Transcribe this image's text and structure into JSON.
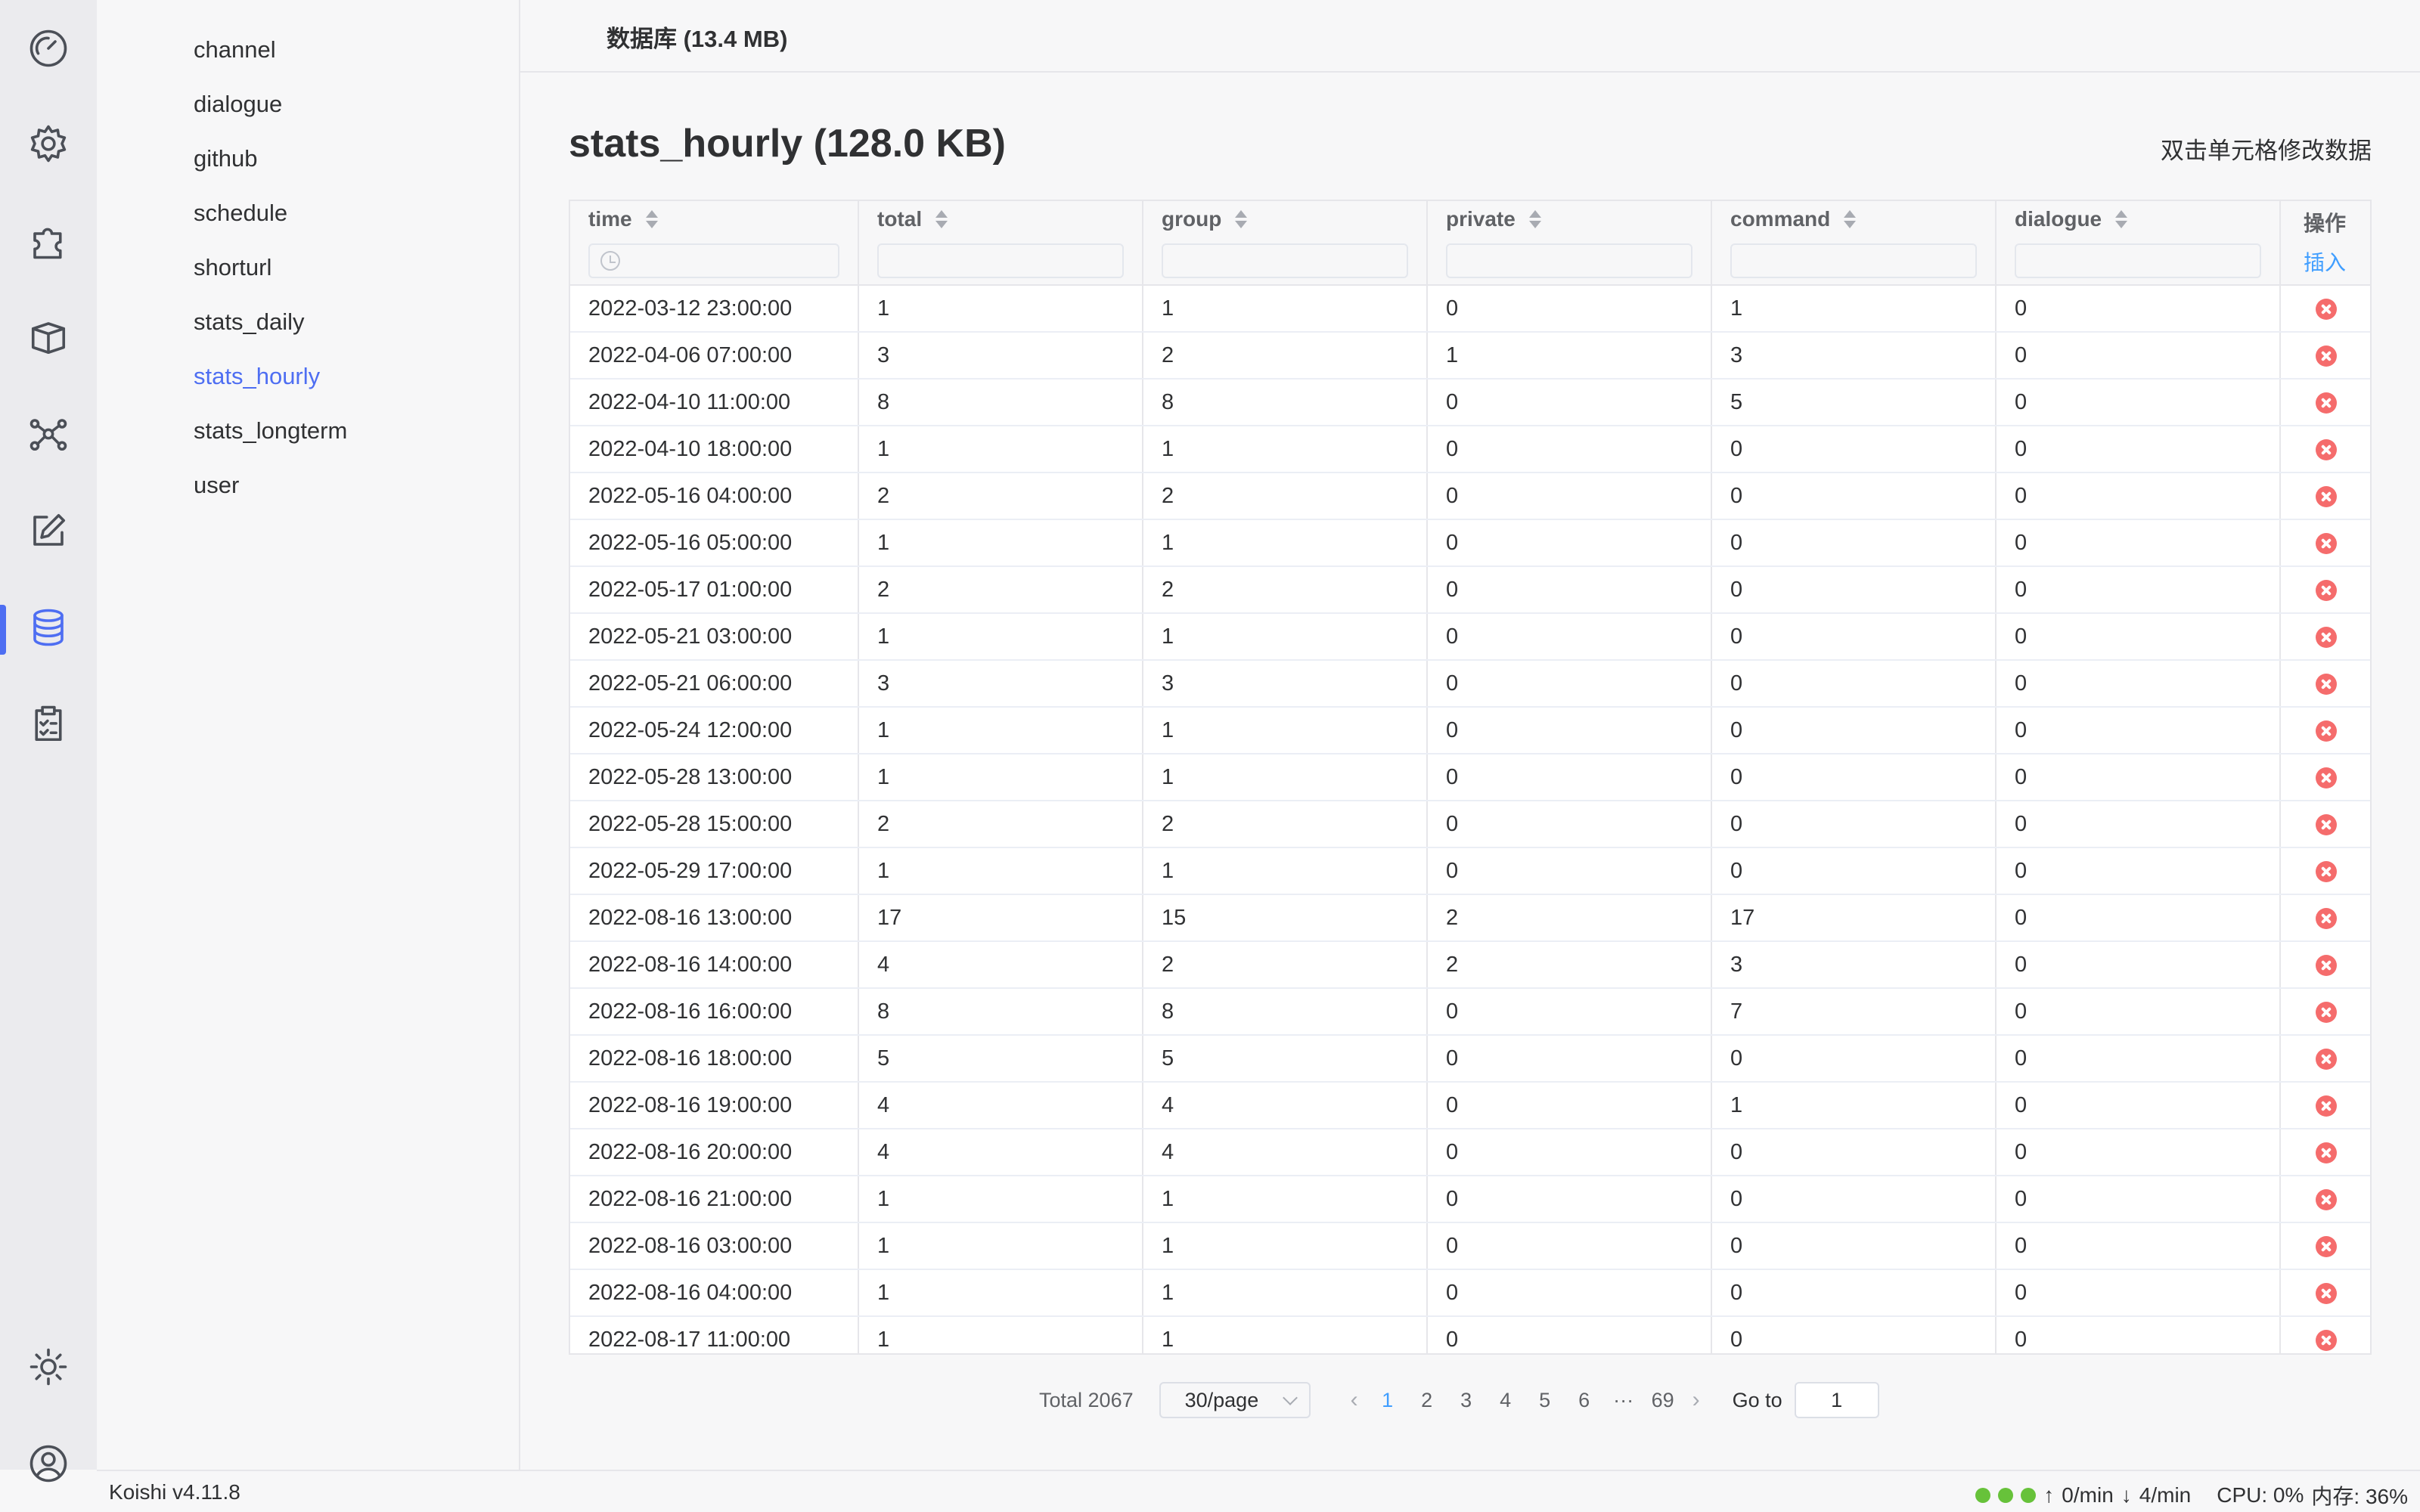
{
  "activity_bar": {
    "icons": [
      "dashboard-icon",
      "settings-icon",
      "plugin-icon",
      "market-box-icon",
      "network-icon",
      "edit-icon",
      "database-icon",
      "checklist-icon",
      "theme-sun-icon",
      "user-icon"
    ],
    "active": "database-icon"
  },
  "sidebar": {
    "items": [
      {
        "label": "channel"
      },
      {
        "label": "dialogue"
      },
      {
        "label": "github"
      },
      {
        "label": "schedule"
      },
      {
        "label": "shorturl"
      },
      {
        "label": "stats_daily"
      },
      {
        "label": "stats_hourly",
        "active": true
      },
      {
        "label": "stats_longterm"
      },
      {
        "label": "user"
      }
    ]
  },
  "header": {
    "title": "数据库 (13.4 MB)"
  },
  "main": {
    "title": "stats_hourly (128.0 KB)",
    "hint": "双击单元格修改数据"
  },
  "table": {
    "columns": [
      "time",
      "total",
      "group",
      "private",
      "command",
      "dialogue"
    ],
    "ops_label": "操作",
    "insert_label": "插入",
    "rows": [
      [
        "2022-03-12 23:00:00",
        "1",
        "1",
        "0",
        "1",
        "0"
      ],
      [
        "2022-04-06 07:00:00",
        "3",
        "2",
        "1",
        "3",
        "0"
      ],
      [
        "2022-04-10 11:00:00",
        "8",
        "8",
        "0",
        "5",
        "0"
      ],
      [
        "2022-04-10 18:00:00",
        "1",
        "1",
        "0",
        "0",
        "0"
      ],
      [
        "2022-05-16 04:00:00",
        "2",
        "2",
        "0",
        "0",
        "0"
      ],
      [
        "2022-05-16 05:00:00",
        "1",
        "1",
        "0",
        "0",
        "0"
      ],
      [
        "2022-05-17 01:00:00",
        "2",
        "2",
        "0",
        "0",
        "0"
      ],
      [
        "2022-05-21 03:00:00",
        "1",
        "1",
        "0",
        "0",
        "0"
      ],
      [
        "2022-05-21 06:00:00",
        "3",
        "3",
        "0",
        "0",
        "0"
      ],
      [
        "2022-05-24 12:00:00",
        "1",
        "1",
        "0",
        "0",
        "0"
      ],
      [
        "2022-05-28 13:00:00",
        "1",
        "1",
        "0",
        "0",
        "0"
      ],
      [
        "2022-05-28 15:00:00",
        "2",
        "2",
        "0",
        "0",
        "0"
      ],
      [
        "2022-05-29 17:00:00",
        "1",
        "1",
        "0",
        "0",
        "0"
      ],
      [
        "2022-08-16 13:00:00",
        "17",
        "15",
        "2",
        "17",
        "0"
      ],
      [
        "2022-08-16 14:00:00",
        "4",
        "2",
        "2",
        "3",
        "0"
      ],
      [
        "2022-08-16 16:00:00",
        "8",
        "8",
        "0",
        "7",
        "0"
      ],
      [
        "2022-08-16 18:00:00",
        "5",
        "5",
        "0",
        "0",
        "0"
      ],
      [
        "2022-08-16 19:00:00",
        "4",
        "4",
        "0",
        "1",
        "0"
      ],
      [
        "2022-08-16 20:00:00",
        "4",
        "4",
        "0",
        "0",
        "0"
      ],
      [
        "2022-08-16 21:00:00",
        "1",
        "1",
        "0",
        "0",
        "0"
      ],
      [
        "2022-08-16 03:00:00",
        "1",
        "1",
        "0",
        "0",
        "0"
      ],
      [
        "2022-08-16 04:00:00",
        "1",
        "1",
        "0",
        "0",
        "0"
      ],
      [
        "2022-08-17 11:00:00",
        "1",
        "1",
        "0",
        "0",
        "0"
      ]
    ]
  },
  "pagination": {
    "total_label": "Total 2067",
    "page_size": "30/page",
    "prev": "‹",
    "next": "›",
    "pages": [
      "1",
      "2",
      "3",
      "4",
      "5",
      "6",
      "···",
      "69"
    ],
    "current": "1",
    "goto_label": "Go to",
    "goto_value": "1"
  },
  "status": {
    "version": "Koishi v4.11.8",
    "indicator_colors": [
      "#67c23a",
      "#67c23a",
      "#67c23a"
    ],
    "sent": "0/min",
    "received": "4/min",
    "cpu": "CPU: 0%",
    "memory": "内存: 36%"
  }
}
